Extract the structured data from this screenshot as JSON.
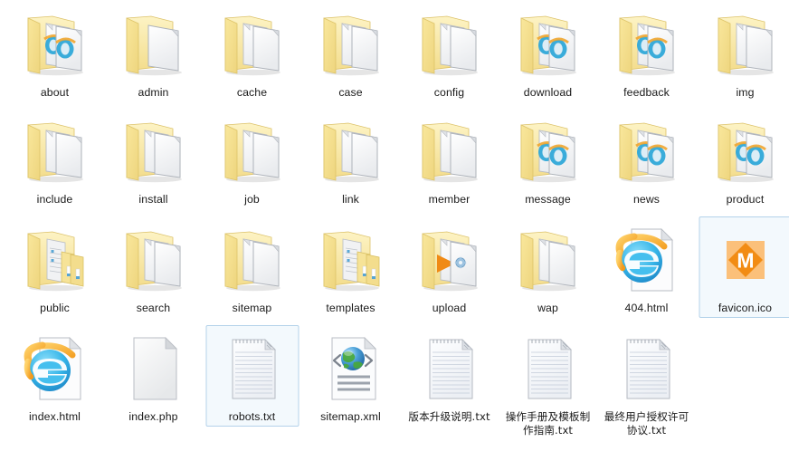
{
  "window": {
    "view": "icon-grid",
    "background_color": "#ffffff",
    "selection_border_color": "#b4d2ea",
    "columns": 8,
    "rows": 4
  },
  "items": [
    {
      "label": "about",
      "icon": "folder-html-docs",
      "type": "folder",
      "selected": false
    },
    {
      "label": "admin",
      "icon": "folder-one-doc",
      "type": "folder",
      "selected": false
    },
    {
      "label": "cache",
      "icon": "folder-docs",
      "type": "folder",
      "selected": false
    },
    {
      "label": "case",
      "icon": "folder-docs",
      "type": "folder",
      "selected": false
    },
    {
      "label": "config",
      "icon": "folder-docs",
      "type": "folder",
      "selected": false
    },
    {
      "label": "download",
      "icon": "folder-html-docs",
      "type": "folder",
      "selected": false
    },
    {
      "label": "feedback",
      "icon": "folder-html-docs",
      "type": "folder",
      "selected": false
    },
    {
      "label": "img",
      "icon": "folder-docs",
      "type": "folder",
      "selected": false
    },
    {
      "label": "include",
      "icon": "folder-docs",
      "type": "folder",
      "selected": false
    },
    {
      "label": "install",
      "icon": "folder-docs",
      "type": "folder",
      "selected": false
    },
    {
      "label": "job",
      "icon": "folder-docs",
      "type": "folder",
      "selected": false
    },
    {
      "label": "link",
      "icon": "folder-docs",
      "type": "folder",
      "selected": false
    },
    {
      "label": "member",
      "icon": "folder-docs",
      "type": "folder",
      "selected": false
    },
    {
      "label": "message",
      "icon": "folder-html-docs",
      "type": "folder",
      "selected": false
    },
    {
      "label": "news",
      "icon": "folder-html-docs",
      "type": "folder",
      "selected": false
    },
    {
      "label": "product",
      "icon": "folder-html-docs",
      "type": "folder",
      "selected": false
    },
    {
      "label": "public",
      "icon": "folder-subfolders",
      "type": "folder",
      "selected": false
    },
    {
      "label": "search",
      "icon": "folder-docs",
      "type": "folder",
      "selected": false
    },
    {
      "label": "sitemap",
      "icon": "folder-docs",
      "type": "folder",
      "selected": false
    },
    {
      "label": "templates",
      "icon": "folder-subfolders",
      "type": "folder",
      "selected": false
    },
    {
      "label": "upload",
      "icon": "folder-media",
      "type": "folder",
      "selected": false
    },
    {
      "label": "wap",
      "icon": "folder-docs",
      "type": "folder",
      "selected": false
    },
    {
      "label": "404.html",
      "icon": "file-ie-html",
      "type": "file",
      "selected": false
    },
    {
      "label": "favicon.ico",
      "icon": "file-ico-m",
      "type": "file",
      "selected": true
    },
    {
      "label": "index.html",
      "icon": "file-ie-html",
      "type": "file",
      "selected": false
    },
    {
      "label": "index.php",
      "icon": "file-blank",
      "type": "file",
      "selected": false
    },
    {
      "label": "robots.txt",
      "icon": "file-text",
      "type": "file",
      "selected": true
    },
    {
      "label": "sitemap.xml",
      "icon": "file-xml",
      "type": "file",
      "selected": false
    },
    {
      "label": "版本升级说明.txt",
      "icon": "file-text",
      "type": "file",
      "selected": false,
      "cjk": true
    },
    {
      "label": "操作手册及模板制作指南.txt",
      "icon": "file-text",
      "type": "file",
      "selected": false,
      "cjk": true
    },
    {
      "label": "最终用户授权许可协议.txt",
      "icon": "file-text",
      "type": "file",
      "selected": false,
      "cjk": true
    }
  ],
  "colors": {
    "folder_front": "#f7e08a",
    "folder_back": "#fbefb0",
    "folder_edge": "#e2c461",
    "page_white": "#ffffff",
    "page_edge": "#b9bdc4",
    "ie_blue": "#36b5e8",
    "ie_orange": "#f5a623",
    "ico_orange": "#f28c14",
    "ico_bg": "#fbc07a",
    "ico_letter": "M",
    "xml_globe_green": "#3f9b34",
    "text_color": "#1a1a1a"
  }
}
